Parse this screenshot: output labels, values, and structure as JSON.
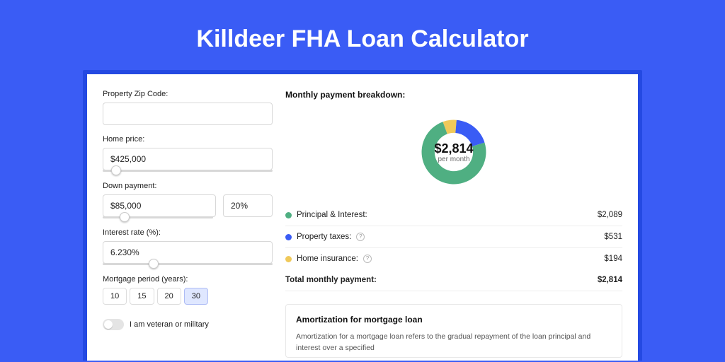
{
  "page_title": "Killdeer FHA Loan Calculator",
  "form": {
    "zip_label": "Property Zip Code:",
    "zip_value": "",
    "home_price_label": "Home price:",
    "home_price_value": "$425,000",
    "home_price_slider_pct": 8,
    "down_payment_label": "Down payment:",
    "down_payment_value": "$85,000",
    "down_payment_pct_value": "20%",
    "down_payment_slider_pct": 20,
    "interest_label": "Interest rate (%):",
    "interest_value": "6.230%",
    "interest_slider_pct": 30,
    "period_label": "Mortgage period (years):",
    "periods": [
      "10",
      "15",
      "20",
      "30"
    ],
    "period_active_index": 3,
    "veteran_label": "I am veteran or military"
  },
  "breakdown": {
    "title": "Monthly payment breakdown:",
    "center_amount": "$2,814",
    "center_sub": "per month",
    "rows": [
      {
        "label": "Principal & Interest:",
        "value": "$2,089",
        "color": "#4FAF82",
        "has_info": false,
        "pct": 74.2
      },
      {
        "label": "Property taxes:",
        "value": "$531",
        "color": "#3A5CF5",
        "has_info": true,
        "pct": 18.9
      },
      {
        "label": "Home insurance:",
        "value": "$194",
        "color": "#F0C95A",
        "has_info": true,
        "pct": 6.9
      }
    ],
    "total_label": "Total monthly payment:",
    "total_value": "$2,814"
  },
  "amort": {
    "title": "Amortization for mortgage loan",
    "body": "Amortization for a mortgage loan refers to the gradual repayment of the loan principal and interest over a specified"
  },
  "chart_data": {
    "type": "pie",
    "title": "Monthly payment breakdown",
    "categories": [
      "Principal & Interest",
      "Property taxes",
      "Home insurance"
    ],
    "values": [
      2089,
      531,
      194
    ],
    "total": 2814,
    "unit": "USD/month",
    "colors": [
      "#4FAF82",
      "#3A5CF5",
      "#F0C95A"
    ]
  }
}
